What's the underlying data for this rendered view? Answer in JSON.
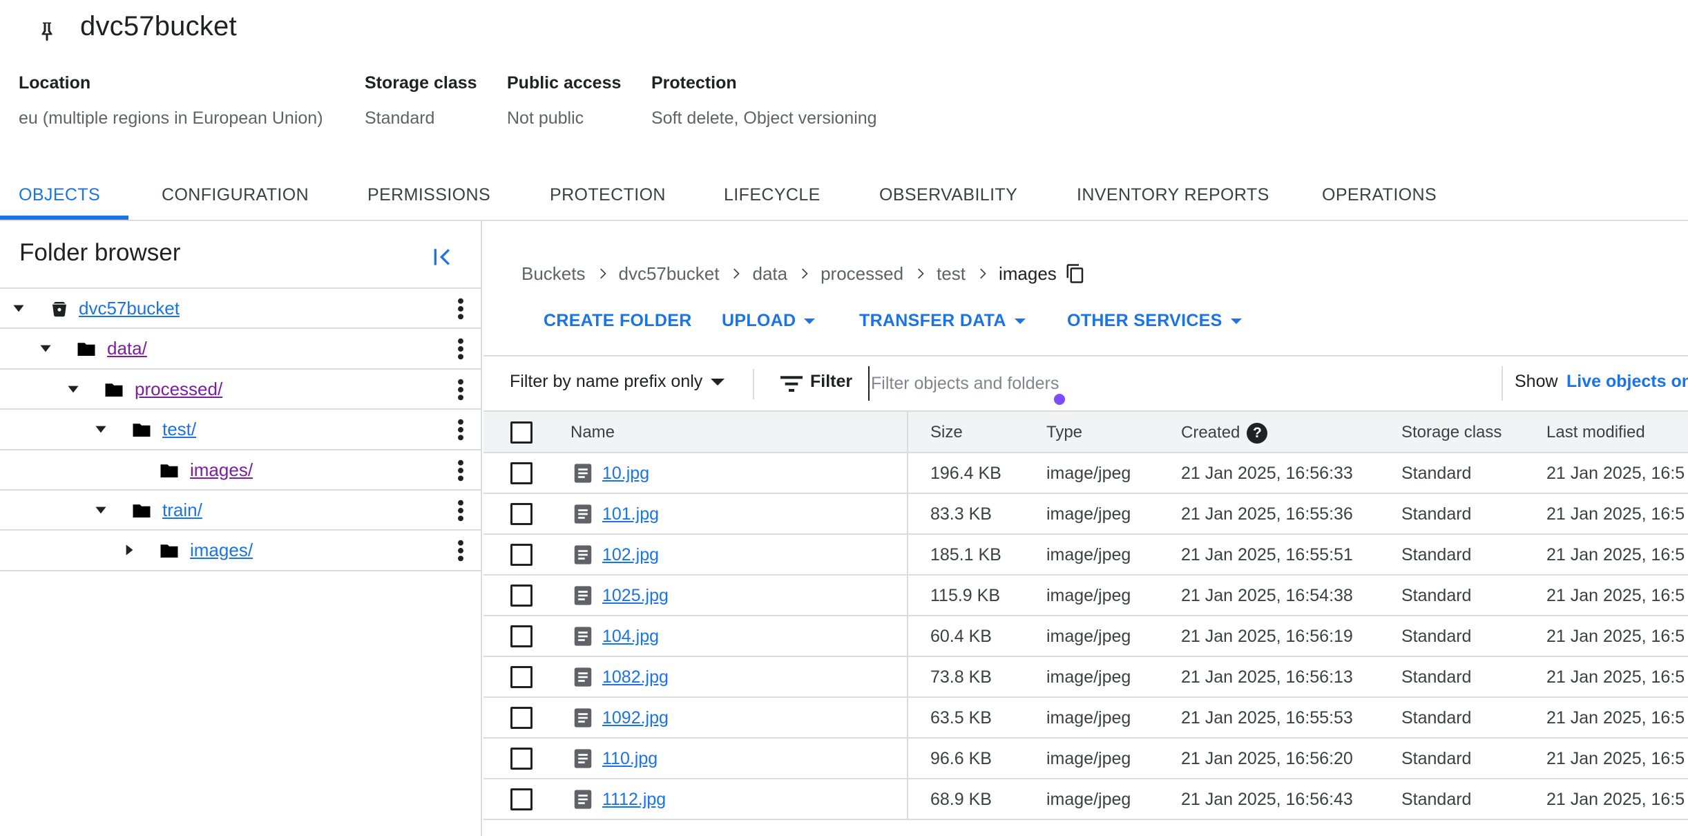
{
  "bucket": {
    "name": "dvc57bucket",
    "pin_icon": "pin-icon",
    "meta": [
      {
        "label": "Location",
        "value": "eu (multiple regions in European Union)"
      },
      {
        "label": "Storage class",
        "value": "Standard"
      },
      {
        "label": "Public access",
        "value": "Not public"
      },
      {
        "label": "Protection",
        "value": "Soft delete, Object versioning"
      }
    ]
  },
  "tabs": [
    {
      "label": "OBJECTS",
      "active": true
    },
    {
      "label": "CONFIGURATION"
    },
    {
      "label": "PERMISSIONS"
    },
    {
      "label": "PROTECTION"
    },
    {
      "label": "LIFECYCLE"
    },
    {
      "label": "OBSERVABILITY"
    },
    {
      "label": "INVENTORY REPORTS"
    },
    {
      "label": "OPERATIONS"
    }
  ],
  "folder_browser": {
    "title": "Folder browser",
    "collapse_icon": "collapse-panel-icon",
    "tree": [
      {
        "label": "dvc57bucket",
        "icon": "bucket-icon",
        "expanded": true
      },
      {
        "label": "data/",
        "icon": "folder-icon",
        "expanded": true
      },
      {
        "label": "processed/",
        "icon": "folder-icon",
        "expanded": true
      },
      {
        "label": "test/",
        "icon": "folder-icon",
        "expanded": true
      },
      {
        "label": "images/",
        "icon": "folder-icon"
      },
      {
        "label": "train/",
        "icon": "folder-icon",
        "expanded": true
      },
      {
        "label": "images/",
        "icon": "folder-icon",
        "expanded": false
      }
    ]
  },
  "breadcrumb": [
    "Buckets",
    "dvc57bucket",
    "data",
    "processed",
    "test",
    "images"
  ],
  "actions": {
    "create_folder": "CREATE FOLDER",
    "upload": "UPLOAD",
    "transfer_data": "TRANSFER DATA",
    "other_services": "OTHER SERVICES"
  },
  "filter": {
    "prefix_option": "Filter by name prefix only",
    "label": "Filter",
    "placeholder": "Filter objects and folders",
    "show_label": "Show",
    "show_value": "Live objects on"
  },
  "table": {
    "columns": {
      "name": "Name",
      "size": "Size",
      "type": "Type",
      "created": "Created",
      "storage_class": "Storage class",
      "last_modified": "Last modified"
    },
    "rows": [
      {
        "name": "10.jpg",
        "size": "196.4 KB",
        "type": "image/jpeg",
        "created": "21 Jan 2025, 16:56:33",
        "storage": "Standard",
        "modified": "21 Jan 2025, 16:5"
      },
      {
        "name": "101.jpg",
        "size": "83.3 KB",
        "type": "image/jpeg",
        "created": "21 Jan 2025, 16:55:36",
        "storage": "Standard",
        "modified": "21 Jan 2025, 16:5"
      },
      {
        "name": "102.jpg",
        "size": "185.1 KB",
        "type": "image/jpeg",
        "created": "21 Jan 2025, 16:55:51",
        "storage": "Standard",
        "modified": "21 Jan 2025, 16:5"
      },
      {
        "name": "1025.jpg",
        "size": "115.9 KB",
        "type": "image/jpeg",
        "created": "21 Jan 2025, 16:54:38",
        "storage": "Standard",
        "modified": "21 Jan 2025, 16:5"
      },
      {
        "name": "104.jpg",
        "size": "60.4 KB",
        "type": "image/jpeg",
        "created": "21 Jan 2025, 16:56:19",
        "storage": "Standard",
        "modified": "21 Jan 2025, 16:5"
      },
      {
        "name": "1082.jpg",
        "size": "73.8 KB",
        "type": "image/jpeg",
        "created": "21 Jan 2025, 16:56:13",
        "storage": "Standard",
        "modified": "21 Jan 2025, 16:5"
      },
      {
        "name": "1092.jpg",
        "size": "63.5 KB",
        "type": "image/jpeg",
        "created": "21 Jan 2025, 16:55:53",
        "storage": "Standard",
        "modified": "21 Jan 2025, 16:5"
      },
      {
        "name": "110.jpg",
        "size": "96.6 KB",
        "type": "image/jpeg",
        "created": "21 Jan 2025, 16:56:20",
        "storage": "Standard",
        "modified": "21 Jan 2025, 16:5"
      },
      {
        "name": "1112.jpg",
        "size": "68.9 KB",
        "type": "image/jpeg",
        "created": "21 Jan 2025, 16:56:43",
        "storage": "Standard",
        "modified": "21 Jan 2025, 16:5"
      }
    ]
  }
}
